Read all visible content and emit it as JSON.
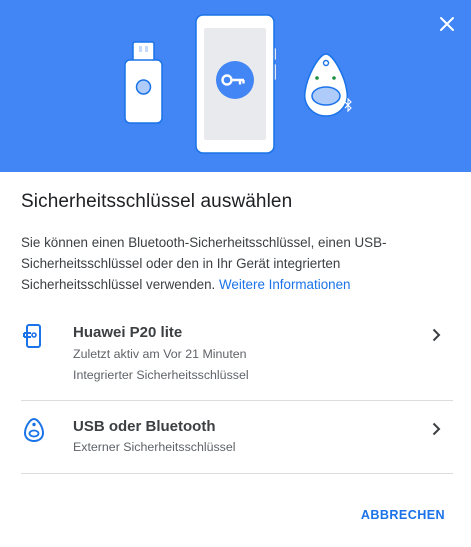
{
  "dialog": {
    "title": "Sicherheitsschlüssel auswählen",
    "description": "Sie können einen Bluetooth-Sicherheitsschlüssel, einen USB-Sicherheitsschlüssel oder den in Ihr Gerät integrierten Sicherheitsschlüssel verwenden.",
    "learn_more_link": "Weitere Informationen",
    "cancel_label": "ABBRECHEN"
  },
  "options": [
    {
      "name": "Huawei P20 lite",
      "line1": "Zuletzt aktiv am Vor 21 Minuten",
      "line2": "Integrierter Sicherheitsschlüssel",
      "icon": "phone-key-icon"
    },
    {
      "name": "USB oder Bluetooth",
      "line1": "Externer Sicherheitsschlüssel",
      "icon": "security-key-icon"
    }
  ],
  "colors": {
    "hero_background": "#4285f4",
    "accent": "#1a73e8",
    "divider": "#dadce0"
  }
}
